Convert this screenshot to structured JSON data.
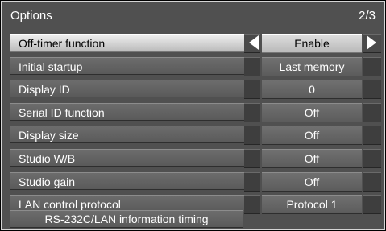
{
  "header": {
    "title": "Options",
    "page": "2/3"
  },
  "settings": [
    {
      "label": "Off-timer function",
      "value": "Enable"
    },
    {
      "label": "Initial startup",
      "value": "Last memory"
    },
    {
      "label": "Display ID",
      "value": "0"
    },
    {
      "label": "Serial ID function",
      "value": "Off"
    },
    {
      "label": "Display size",
      "value": "Off"
    },
    {
      "label": "Studio W/B",
      "value": "Off"
    },
    {
      "label": "Studio gain",
      "value": "Off"
    },
    {
      "label": "LAN control protocol",
      "value": "Protocol 1"
    }
  ],
  "footer_item": {
    "label": "RS-232C/LAN information timing"
  },
  "icons": {
    "left": "arrow-left-icon",
    "right": "arrow-right-icon"
  }
}
